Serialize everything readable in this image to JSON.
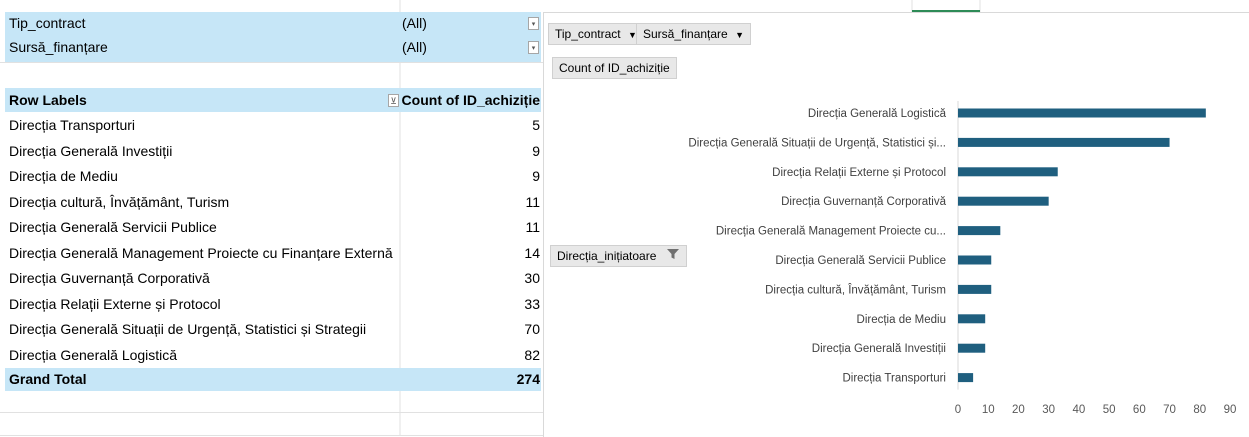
{
  "filters": [
    {
      "field": "Tip_contract",
      "value": "(All)"
    },
    {
      "field": "Sursă_finanțare",
      "value": "(All)"
    }
  ],
  "pivot": {
    "row_labels_header": "Row Labels",
    "count_header": "Count of ID_achiziție",
    "rows": [
      {
        "label": "Direcția Transporturi",
        "count": "5"
      },
      {
        "label": "Direcția Generală Investiții",
        "count": "9"
      },
      {
        "label": "Direcția de Mediu",
        "count": "9"
      },
      {
        "label": "Direcția cultură, Învățământ, Turism",
        "count": "11"
      },
      {
        "label": "Direcția Generală Servicii Publice",
        "count": "11"
      },
      {
        "label": "Direcția Generală Management Proiecte cu Finanțare Externă",
        "count": "14"
      },
      {
        "label": "Direcția Guvernanță Corporativă",
        "count": "30"
      },
      {
        "label": "Direcția Relații Externe și Protocol",
        "count": "33"
      },
      {
        "label": "Direcția Generală Situații de Urgență, Statistici și Strategii",
        "count": "70"
      },
      {
        "label": "Direcția Generală Logistică",
        "count": "82"
      }
    ],
    "grand_total_label": "Grand Total",
    "grand_total_value": "274"
  },
  "chart_fields": {
    "filter_buttons": [
      "Tip_contract",
      "Sursă_finanțare"
    ],
    "value_button": "Count of ID_achiziție",
    "axis_button": "Direcția_inițiatoare"
  },
  "colors": {
    "bar": "#1f5f7f",
    "header_fill": "#c6e6f7",
    "field_button": "#e8e8e8"
  },
  "chart_data": {
    "type": "bar",
    "orientation": "horizontal",
    "categories": [
      "Direcția Generală Logistică",
      "Direcția Generală Situații de Urgență, Statistici și...",
      "Direcția Relații Externe și Protocol",
      "Direcția Guvernanță Corporativă",
      "Direcția Generală Management Proiecte cu...",
      "Direcția Generală Servicii Publice",
      "Direcția cultură, Învățământ, Turism",
      "Direcția de Mediu",
      "Direcția Generală Investiții",
      "Direcția Transporturi"
    ],
    "values": [
      82,
      70,
      33,
      30,
      14,
      11,
      11,
      9,
      9,
      5
    ],
    "xlim": [
      0,
      90
    ],
    "ticks": [
      "0",
      "10",
      "20",
      "30",
      "40",
      "50",
      "60",
      "70",
      "80",
      "90"
    ],
    "grid": false,
    "legend": "none"
  }
}
